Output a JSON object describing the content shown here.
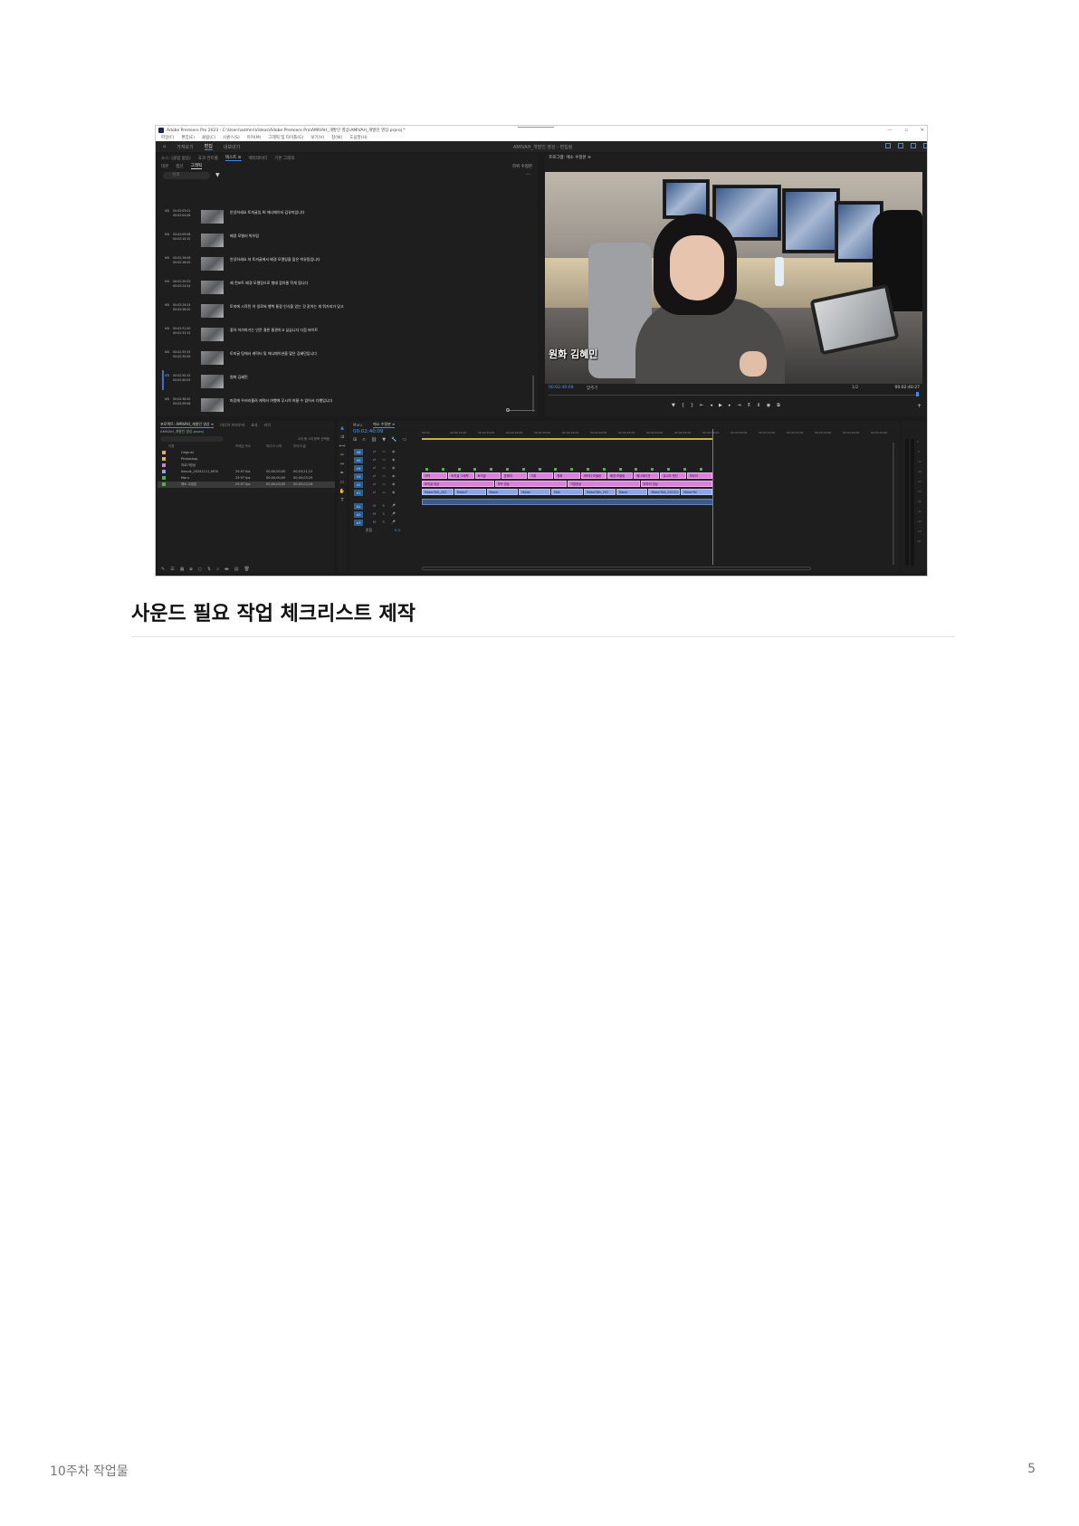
{
  "app": {
    "title": "Adobe Premiere Pro 2023 - C:\\Users\\admin\\Videos\\Adobe Premiere Pro\\AMIVAH_개발인 영상\\AMIVAH_개발인 영상.prproj *",
    "menu": [
      "파일(F)",
      "편집(E)",
      "클립(C)",
      "시퀀스(S)",
      "마커(M)",
      "그래픽 및 타이틀(G)",
      "보기(V)",
      "창(W)",
      "도움말(H)"
    ],
    "workspace_tabs": [
      "가져오기",
      "편집",
      "내보내기"
    ],
    "workspace_active": "편집",
    "project_title": "AMIVAH_개발인 영상 - 편집됨"
  },
  "text_panel": {
    "tabs": [
      "소스: (클립 없음)",
      "효과 컨트롤",
      "텍스트 ≡",
      "메타데이터",
      "기본 그래픽"
    ],
    "subtabs": [
      "대본",
      "캡션",
      "그래픽"
    ],
    "subtab_active": "그래픽",
    "track_selector": "하위 수정본",
    "search_placeholder": "검색",
    "captions": [
      {
        "track": "V4",
        "tc_in": "00:02:03:01",
        "tc_out": "00:02:04:06",
        "text": "안녕하세요 토끼굴입 AI 애니메이터 김유미입니다"
      },
      {
        "track": "V4",
        "tc_in": "00:02:09:06",
        "tc_out": "00:02:10:15",
        "text": "배경 모델러 박유림"
      },
      {
        "track": "V4",
        "tc_in": "00:02:16:06",
        "tc_out": "00:02:18:05",
        "text": "안녕하세요 저 토끼굴에서 배경 모델링을 맡은 박유림입니다"
      },
      {
        "track": "V4",
        "tc_in": "00:02:20:03",
        "tc_out": "00:02:24:24",
        "text": "제 컨포트 배경 모델링으로 형태 잡아줄 작게 됩니다"
      },
      {
        "track": "V4",
        "tc_in": "00:02:24:24",
        "tc_out": "00:02:28:00",
        "text": "토끼에 시작된 이 일로써 행복 통장 인식을 얻는 것 같아는 게 뭐가지가 있고"
      },
      {
        "track": "V4",
        "tc_in": "00:02:31:00",
        "tc_out": "00:02:33:15",
        "text": "좋아 아가파가는 인문 결론 통관하고 싶습니다 다음 바이트"
      },
      {
        "track": "V4",
        "tc_in": "00:02:33:15",
        "tc_out": "00:02:35:00",
        "text": "토끼굴 팀에서 캐릭터 및 애니메이션을 맡은 김혜민입니다"
      },
      {
        "track": "V3",
        "tc_in": "00:02:35:15",
        "tc_out": "00:02:40:05",
        "text": "원화 김혜민"
      },
      {
        "track": "V4",
        "tc_in": "00:02:36:20",
        "tc_out": "00:02:39:06",
        "text": "마음에 우러러올려 캐릭터 여행에 무시히 허물 수 있어서 다행입니다"
      }
    ],
    "selected_index": 7
  },
  "program": {
    "title": "프로그램: 에소 수정본 ≡",
    "subtitle": "원화 김혜민",
    "timecode": "00:02:40:09",
    "fit": "맞추기",
    "quality": "1/2",
    "duration": "00:02:40:27"
  },
  "project": {
    "tabs": [
      "프로젝트: AMIVAH_개발인 영상 ≡",
      "미디어 브라우저",
      "효과",
      "라이"
    ],
    "path": "AMIVAH_개발인 영상.prproj",
    "count": "4개 중 1개 항목 선택됨",
    "headers": [
      "이름",
      "프레임 속도",
      "미디어 시작",
      "미디어 끝"
    ],
    "items": [
      {
        "name": "Original",
        "fps": "",
        "start": "",
        "end": "",
        "color": "#e2b43a"
      },
      {
        "name": "Photoshop",
        "fps": "",
        "start": "",
        "end": "",
        "color": "#e2b43a"
      },
      {
        "name": "자르기영상",
        "fps": "",
        "start": "",
        "end": "",
        "color": "#d67fd8"
      },
      {
        "name": "Seoulk_20241111_MOV",
        "fps": "29.97 fps",
        "start": "00;00;00;00",
        "end": "00;03;21;12",
        "color": "#8aa6e8"
      },
      {
        "name": "Maru",
        "fps": "29.97 fps",
        "start": "00;00;00;00",
        "end": "00;00;03;29",
        "color": "#4fae4f"
      },
      {
        "name": "에소 수정본",
        "fps": "29.97 fps",
        "start": "00;00;00;00",
        "end": "00;03;03;16",
        "color": "#4fae4f"
      }
    ],
    "selected_index": 5
  },
  "timeline": {
    "tabs": [
      "Maru",
      "에소 수정본 ≡"
    ],
    "timecode": "00:02:40:09",
    "ruler": [
      "00:00",
      "00:02:15:00",
      "00:02:20:00",
      "00:02:25:00",
      "00:02:30:00",
      "00:02:35:00",
      "00:02:40:00",
      "00:02:45:00",
      "00:02:50:00",
      "00:02:55:00",
      "00:03:00:00",
      "00:03:05:00",
      "00:03:10:00",
      "00:03:15:00",
      "00:03:20:00",
      "00:03:25:00",
      "00:03:30:00"
    ],
    "video_tracks": [
      "V6",
      "V5",
      "V4",
      "V3",
      "V2",
      "V1"
    ],
    "audio_tracks": [
      "A1",
      "A2",
      "A3"
    ],
    "mix_label": "혼합",
    "mix_value": "0.0",
    "clips_v4": [
      "자막",
      "토끼굴 그래픽",
      "토끼굴",
      "표제지",
      "기록",
      "원화",
      "캐릭터 모델링",
      "배경 모델링",
      "애니메이션",
      "유니티 엔진",
      "마무리"
    ],
    "clips_v3": [
      "토끼굴 영상",
      "자막 영상",
      "기업영상",
      "마무리 영상"
    ],
    "clips_v1": [
      "MakerTalk_202",
      "MakerT",
      "Maker",
      "Maker",
      "Mak",
      "MakerTalk_202",
      "Maker",
      "MakerTalk_202411",
      "MakerTal"
    ]
  },
  "page": {
    "heading": "사운드 필요 작업 체크리스트 제작",
    "footer_left": "10주차 작업물",
    "page_number": "5"
  }
}
